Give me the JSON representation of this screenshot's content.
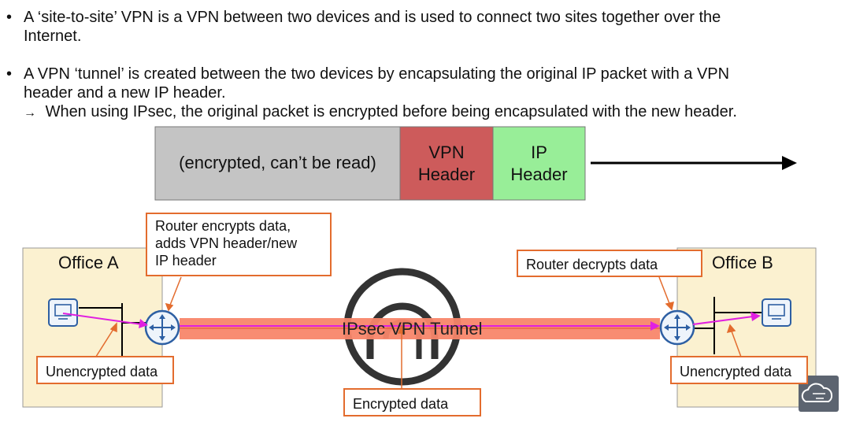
{
  "bullets": [
    {
      "symbol": "•",
      "line1": "A ‘site-to-site’ VPN is a VPN between two devices and is used to connect two sites together over the",
      "line2": "Internet."
    },
    {
      "symbol": "•",
      "line1": "A VPN ‘tunnel’ is created between the two devices by encapsulating the original IP packet with a VPN",
      "line2": "header and a new IP header."
    }
  ],
  "sub_bullet": {
    "symbol": "→",
    "text": "When using IPsec, the original packet is encrypted before being encapsulated with the new header."
  },
  "packet": {
    "payload_label": "(encrypted, can’t be read)",
    "vpn_header_line1": "VPN",
    "vpn_header_line2": "Header",
    "ip_header_line1": "IP",
    "ip_header_line2": "Header",
    "colors": {
      "payload": "#c4c4c4",
      "vpn": "#cd5b5b",
      "ip": "#98ee98"
    }
  },
  "offices": {
    "a": "Office A",
    "b": "Office B"
  },
  "tunnel": {
    "label": "IPsec VPN Tunnel",
    "color": "#f8866a"
  },
  "callouts": {
    "router_encrypts_1": "Router encrypts data,",
    "router_encrypts_2": "adds VPN header/new",
    "router_encrypts_3": "IP header",
    "router_decrypts": "Router decrypts data",
    "unencrypted_a": "Unencrypted data",
    "unencrypted_b": "Unencrypted data",
    "encrypted": "Encrypted data"
  },
  "icons": {
    "pc": "pc-icon",
    "router": "router-icon",
    "cloud": "cloud-logo-icon"
  },
  "colors": {
    "office_bg": "#fbf1d0",
    "callout_border": "#e36c2e",
    "router": "#2d5fa3",
    "flow_arrow": "#e020e0"
  }
}
